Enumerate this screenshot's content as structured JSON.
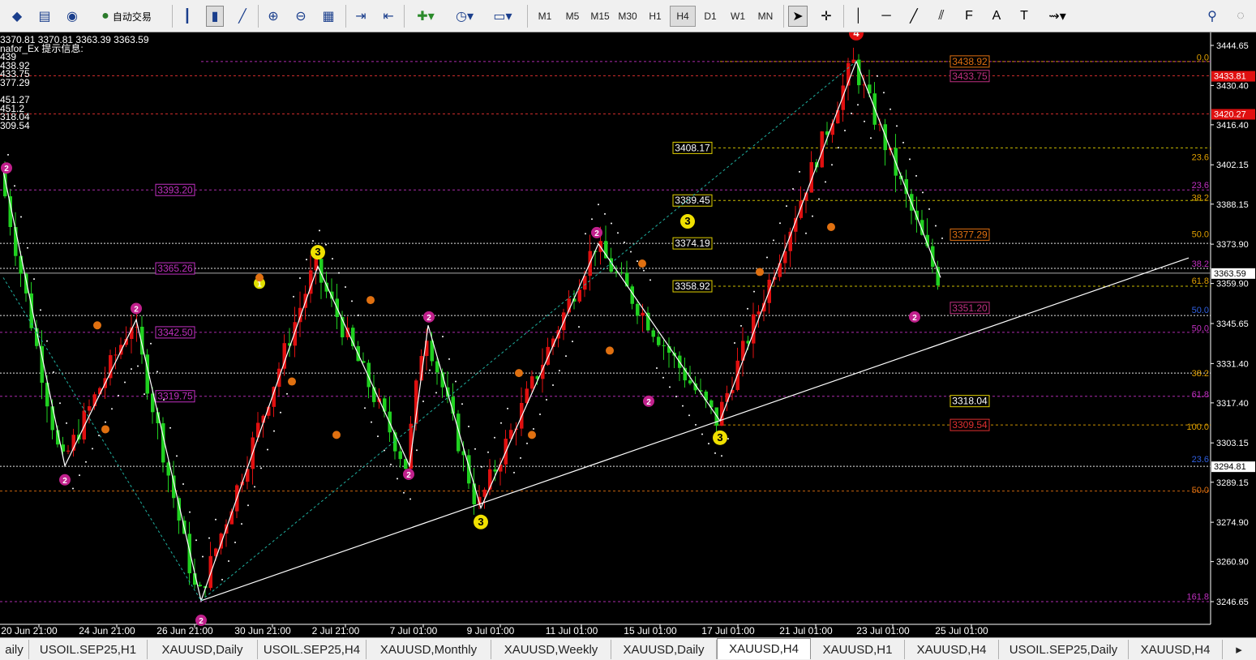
{
  "toolbar": {
    "auto_trade_label": "自动交易",
    "timeframes": [
      "M1",
      "M5",
      "M15",
      "M30",
      "H1",
      "H4",
      "D1",
      "W1",
      "MN"
    ],
    "active_timeframe": "H4"
  },
  "info_panel": {
    "ohlc": "3370.81 3370.81 3363.39 3363.59",
    "indicator_title": "nafor_Ex 提示信息:",
    "values": [
      "439",
      "438.92",
      "433.75",
      "377.29",
      "",
      "451.27",
      "451.2",
      "318.04",
      "309.54"
    ]
  },
  "price_axis": {
    "labels": [
      "3444.65",
      "3430.40",
      "3416.40",
      "3402.15",
      "3388.15",
      "3373.90",
      "3359.90",
      "3345.65",
      "3331.40",
      "3317.40",
      "3303.15",
      "3289.15",
      "3274.90",
      "3260.90",
      "3246.65"
    ],
    "current_price": "3363.59",
    "marker_price": "3294.81",
    "red_labels": [
      "3433.81",
      "3420.27"
    ]
  },
  "time_axis": {
    "labels": [
      "20 Jun 21:00",
      "24 Jun 21:00",
      "26 Jun 21:00",
      "30 Jun 21:00",
      "2 Jul 21:00",
      "7 Jul 01:00",
      "9 Jul 01:00",
      "11 Jul 01:00",
      "15 Jul 01:00",
      "17 Jul 01:00",
      "21 Jul 01:00",
      "23 Jul 01:00",
      "25 Jul 01:00"
    ]
  },
  "level_boxes": [
    {
      "text": "3393.20",
      "color": "#c030c0"
    },
    {
      "text": "3365.26",
      "color": "#c030c0"
    },
    {
      "text": "3342.50",
      "color": "#c030c0"
    },
    {
      "text": "3319.75",
      "color": "#c030c0"
    },
    {
      "text": "3408.17",
      "color": "#e0d000"
    },
    {
      "text": "3389.45",
      "color": "#e0d000"
    },
    {
      "text": "3374.19",
      "color": "#e0d000"
    },
    {
      "text": "3358.92",
      "color": "#e0d000"
    },
    {
      "text": "3438.92",
      "color": "#e07010"
    },
    {
      "text": "3433.75",
      "color": "#c03080"
    },
    {
      "text": "3377.29",
      "color": "#e07010"
    },
    {
      "text": "3351.20",
      "color": "#c03080"
    },
    {
      "text": "3318.04",
      "color": "#e0d000"
    },
    {
      "text": "3309.54",
      "color": "#e03030"
    }
  ],
  "fib_labels": [
    {
      "text": "0.0",
      "color": "#e0a000"
    },
    {
      "text": "23.6",
      "color": "#e0a000"
    },
    {
      "text": "23.6",
      "color": "#c030c0"
    },
    {
      "text": "38.2",
      "color": "#e0a000"
    },
    {
      "text": "50.0",
      "color": "#e0a000"
    },
    {
      "text": "38.2",
      "color": "#c030c0"
    },
    {
      "text": "61.8",
      "color": "#e0a000"
    },
    {
      "text": "50.0",
      "color": "#3060e0"
    },
    {
      "text": "50.0",
      "color": "#c030c0"
    },
    {
      "text": "38.2",
      "color": "#e0a000"
    },
    {
      "text": "61.8",
      "color": "#c030c0"
    },
    {
      "text": "100.0",
      "color": "#e0a000"
    },
    {
      "text": "23.6",
      "color": "#3060e0"
    },
    {
      "text": "50.0",
      "color": "#e07010"
    },
    {
      "text": "161.8",
      "color": "#c030c0"
    }
  ],
  "wave_markers": [
    {
      "label": "2",
      "color": "#c0208c"
    },
    {
      "label": "2",
      "color": "#c0208c"
    },
    {
      "label": "2",
      "color": "#c0208c"
    },
    {
      "label": "3",
      "color": "#f0e000"
    },
    {
      "label": "2",
      "color": "#c0208c"
    },
    {
      "label": "2",
      "color": "#c0208c"
    },
    {
      "label": "3",
      "color": "#f0e000"
    },
    {
      "label": "2",
      "color": "#c0208c"
    },
    {
      "label": "2",
      "color": "#c0208c"
    },
    {
      "label": "3",
      "color": "#f0e000"
    },
    {
      "label": "3",
      "color": "#f0e000"
    },
    {
      "label": "4",
      "color": "#e01010"
    },
    {
      "label": "2",
      "color": "#c0208c"
    },
    {
      "label": "2",
      "color": "#c0208c"
    },
    {
      "label": "1",
      "color": "#e0e000"
    }
  ],
  "tabs": [
    {
      "label": "aily"
    },
    {
      "label": "USOIL.SEP25,H1"
    },
    {
      "label": "XAUUSD,Daily"
    },
    {
      "label": "USOIL.SEP25,H4"
    },
    {
      "label": "XAUUSD,Monthly"
    },
    {
      "label": "XAUUSD,Weekly"
    },
    {
      "label": "XAUUSD,Daily"
    },
    {
      "label": "XAUUSD,H4"
    },
    {
      "label": "XAUUSD,H1"
    },
    {
      "label": "XAUUSD,H4"
    },
    {
      "label": "USOIL.SEP25,Daily"
    },
    {
      "label": "XAUUSD,H4"
    }
  ],
  "active_tab_index": 7
}
